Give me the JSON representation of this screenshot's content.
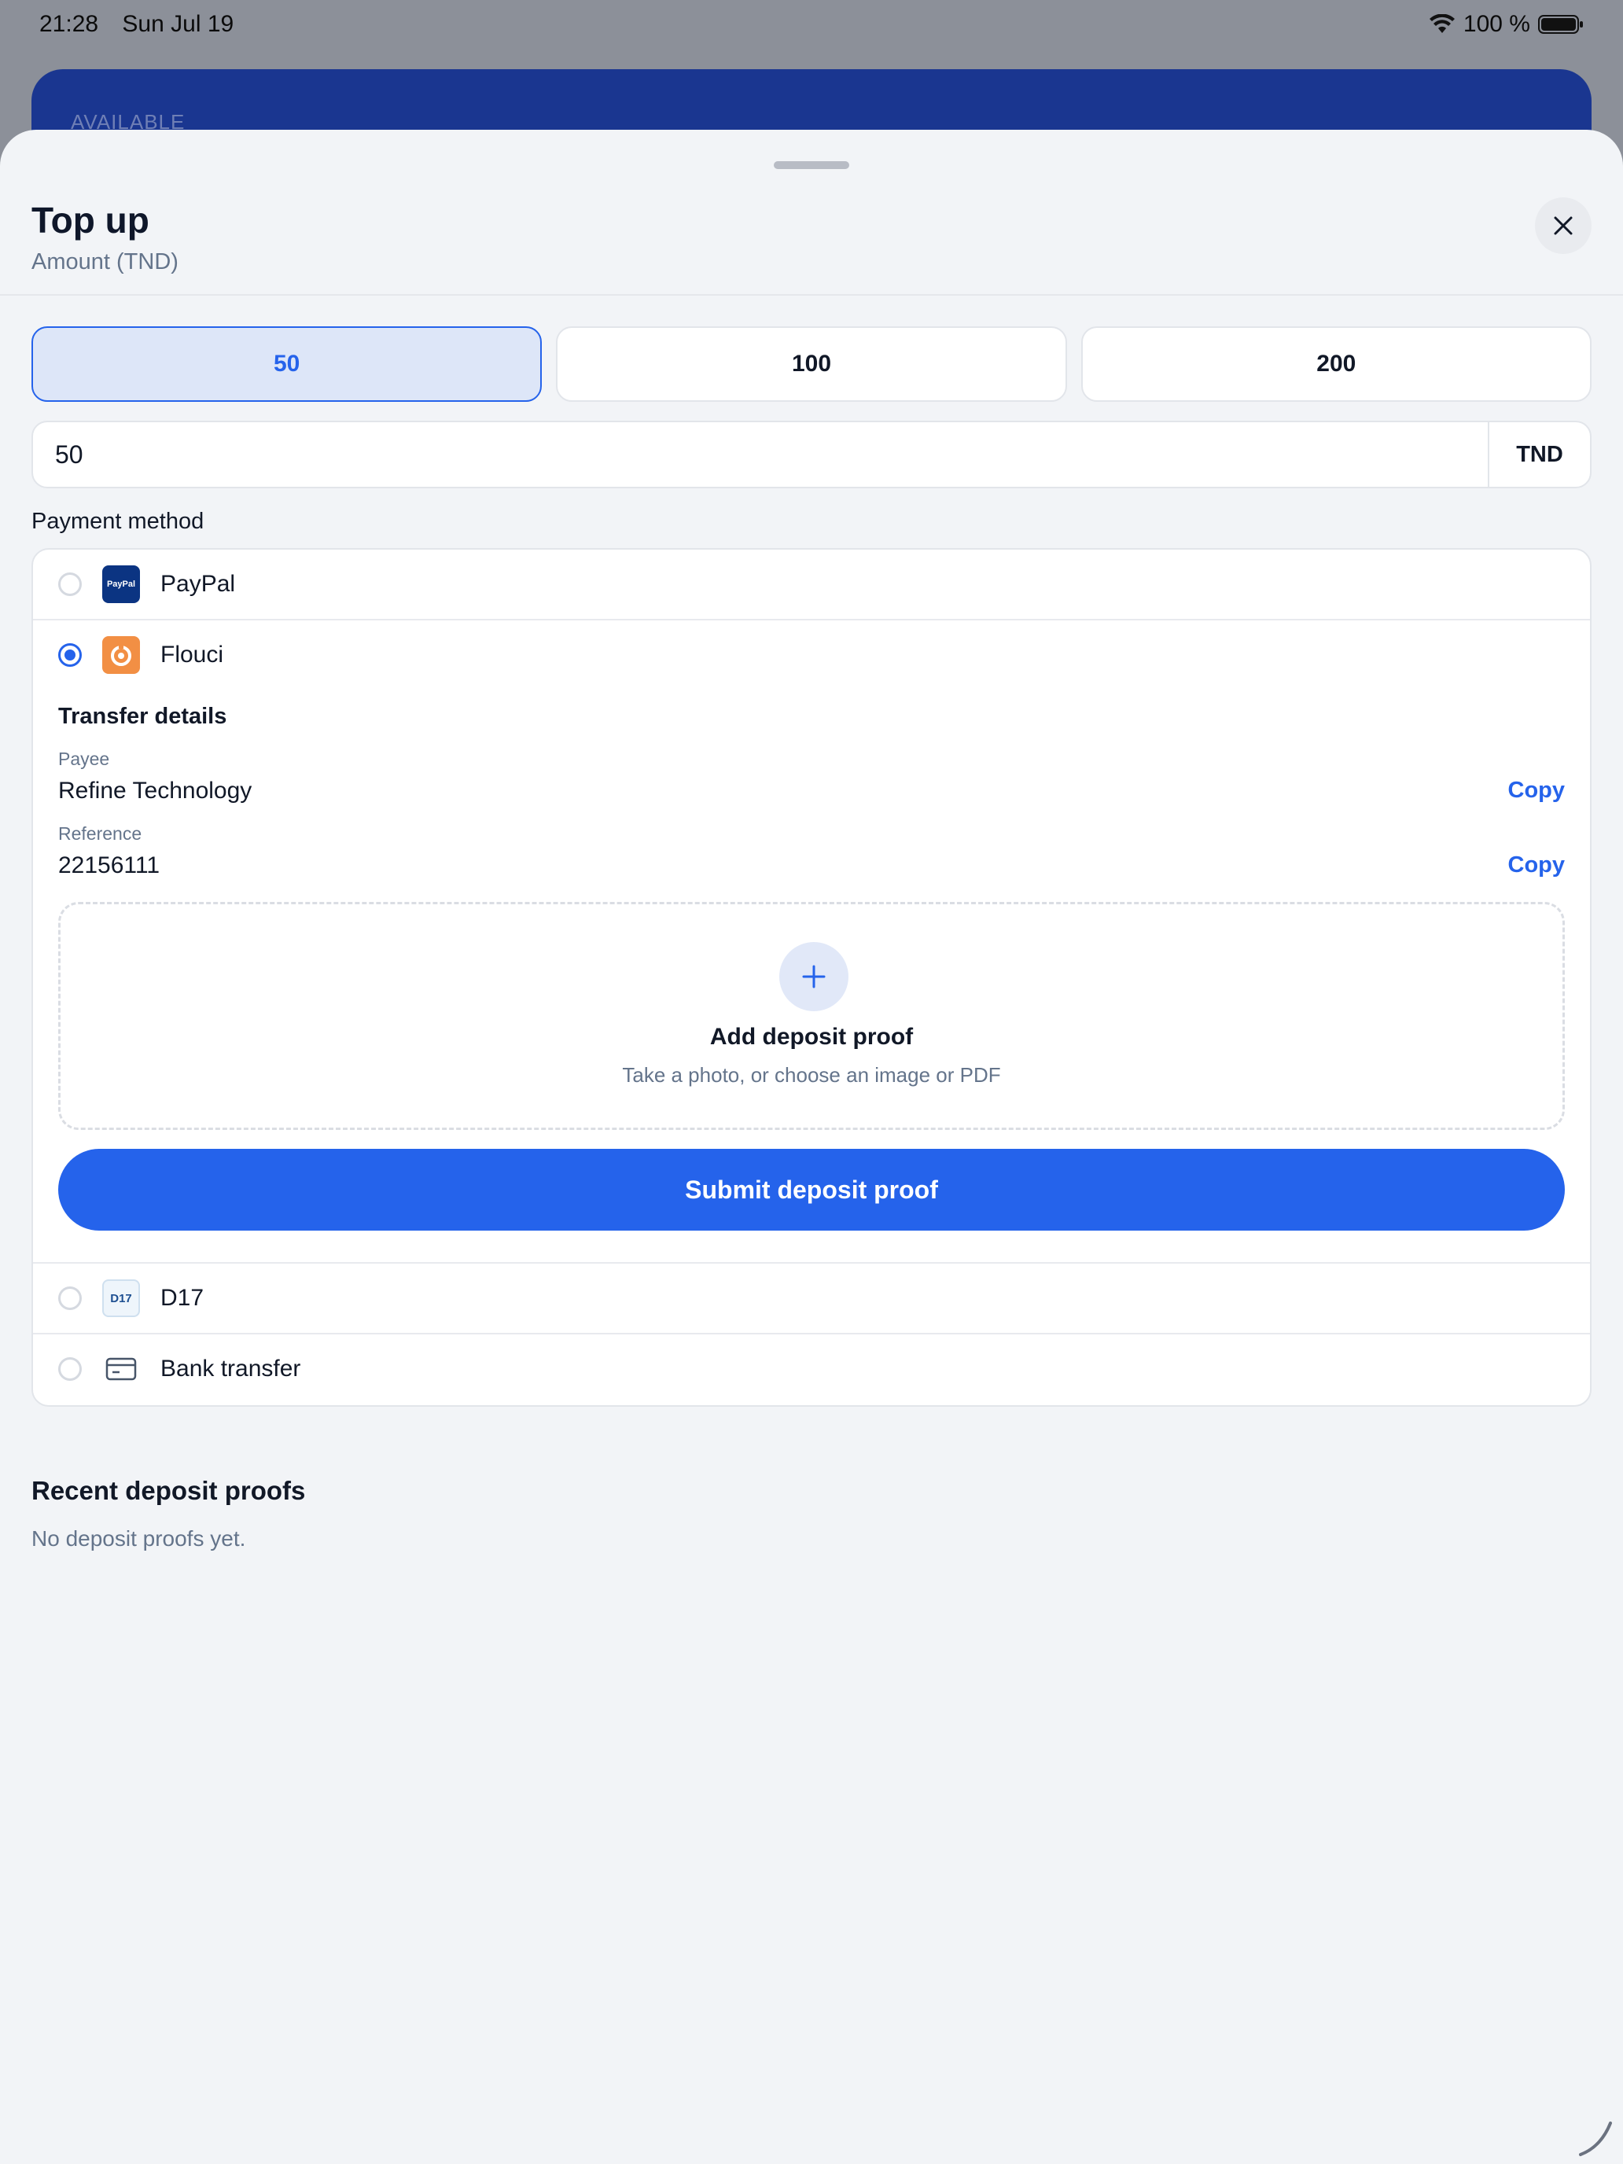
{
  "status_bar": {
    "time": "21:28",
    "date": "Sun Jul 19",
    "battery": "100 %"
  },
  "background": {
    "card_label": "AVAILABLE"
  },
  "sheet": {
    "title": "Top up",
    "subtitle": "Amount (TND)",
    "amount_presets": [
      {
        "label": "50",
        "selected": true
      },
      {
        "label": "100",
        "selected": false
      },
      {
        "label": "200",
        "selected": false
      }
    ],
    "amount_input": {
      "value": "50",
      "unit": "TND"
    },
    "payment_section_label": "Payment method",
    "methods": [
      {
        "label": "PayPal",
        "selected": false,
        "logo_text": "PayPal"
      },
      {
        "label": "Flouci",
        "selected": true
      },
      {
        "label": "D17",
        "selected": false,
        "logo_text": "D17"
      },
      {
        "label": "Bank transfer",
        "selected": false
      }
    ],
    "transfer_details": {
      "title": "Transfer details",
      "payee_label": "Payee",
      "payee_value": "Refine Technology",
      "reference_label": "Reference",
      "reference_value": "22156111",
      "copy_label": "Copy"
    },
    "dropzone": {
      "title": "Add deposit proof",
      "subtitle": "Take a photo, or choose an image or PDF"
    },
    "submit_label": "Submit deposit proof",
    "recent": {
      "title": "Recent deposit proofs",
      "empty": "No deposit proofs yet."
    }
  },
  "colors": {
    "accent": "#2563eb",
    "accent_light": "#dde6f8",
    "sheet_bg": "#f2f4f7",
    "bg_card": "#1a3690"
  }
}
